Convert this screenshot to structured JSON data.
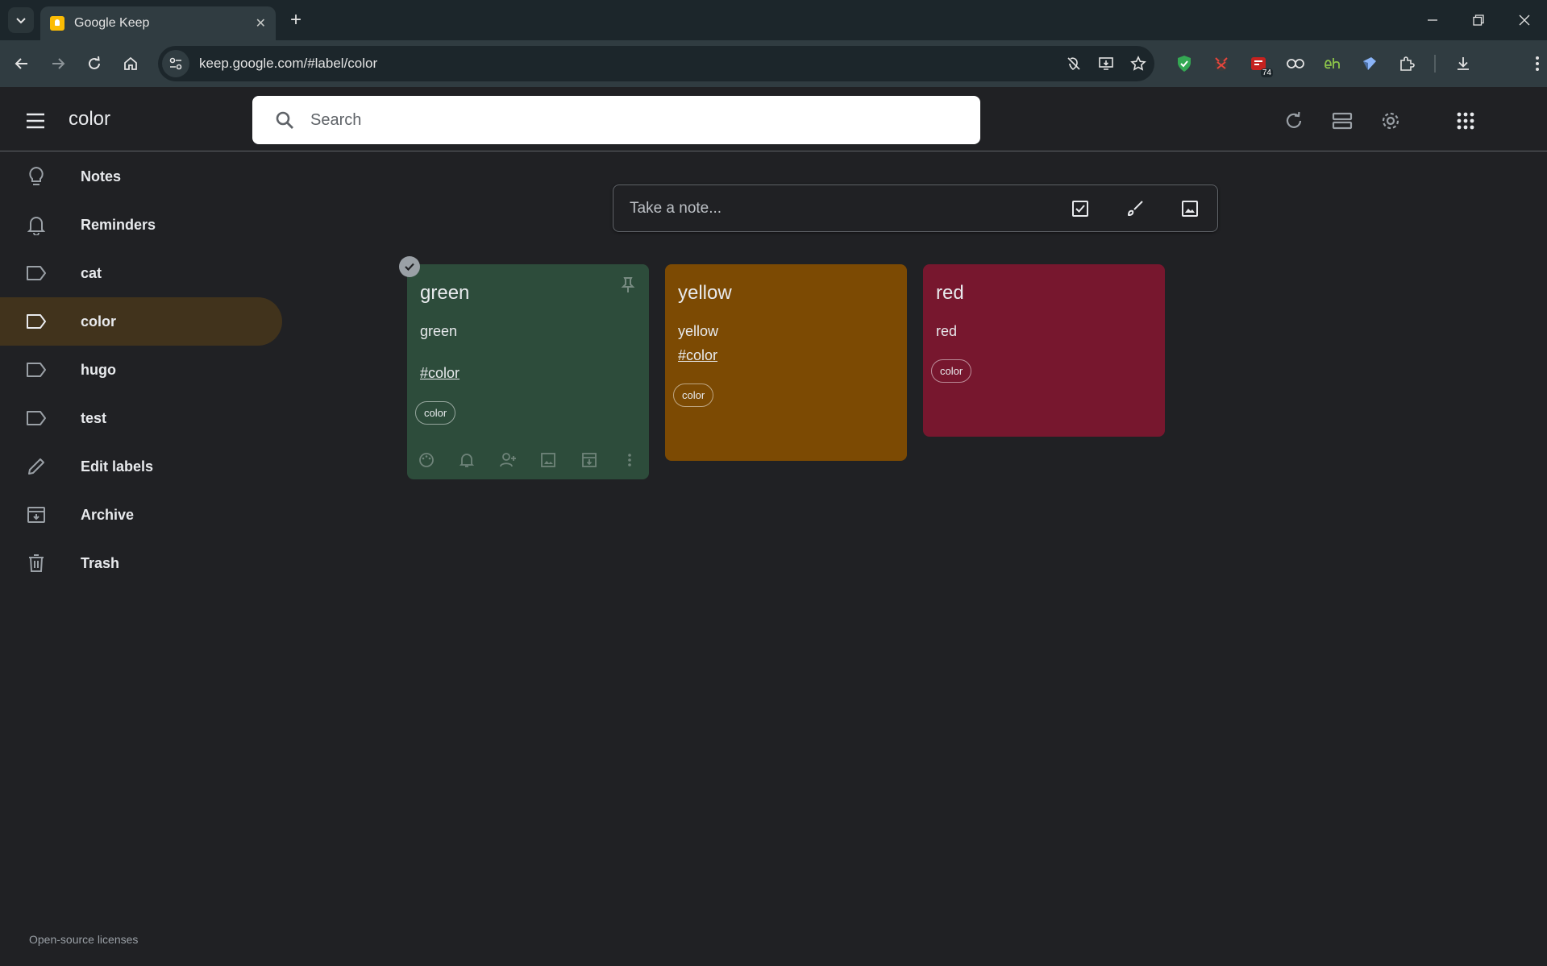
{
  "browser": {
    "tab_title": "Google Keep",
    "url": "keep.google.com/#label/color",
    "extension_badge": "74"
  },
  "header": {
    "title": "color",
    "search_placeholder": "Search"
  },
  "sidebar": {
    "items": [
      {
        "label": "Notes",
        "icon": "lightbulb-icon"
      },
      {
        "label": "Reminders",
        "icon": "bell-icon"
      },
      {
        "label": "cat",
        "icon": "label-icon"
      },
      {
        "label": "color",
        "icon": "label-icon",
        "active": true
      },
      {
        "label": "hugo",
        "icon": "label-icon"
      },
      {
        "label": "test",
        "icon": "label-icon"
      },
      {
        "label": "Edit labels",
        "icon": "pencil-icon"
      },
      {
        "label": "Archive",
        "icon": "archive-icon"
      },
      {
        "label": "Trash",
        "icon": "trash-icon"
      }
    ],
    "footer_link": "Open-source licenses"
  },
  "take_note": {
    "placeholder": "Take a note..."
  },
  "notes": [
    {
      "title": "green",
      "body": "green",
      "hashtag": "#color",
      "label": "color",
      "color": "#2d4c3b"
    },
    {
      "title": "yellow",
      "body": "yellow",
      "hashtag": "#color",
      "label": "color",
      "color": "#7c4a03"
    },
    {
      "title": "red",
      "body": "red",
      "hashtag": "",
      "label": "color",
      "color": "#77172e"
    }
  ],
  "colors": {
    "background": "#202124",
    "chrome_toolbar": "#303c41",
    "active_sidebar": "#41331c"
  }
}
